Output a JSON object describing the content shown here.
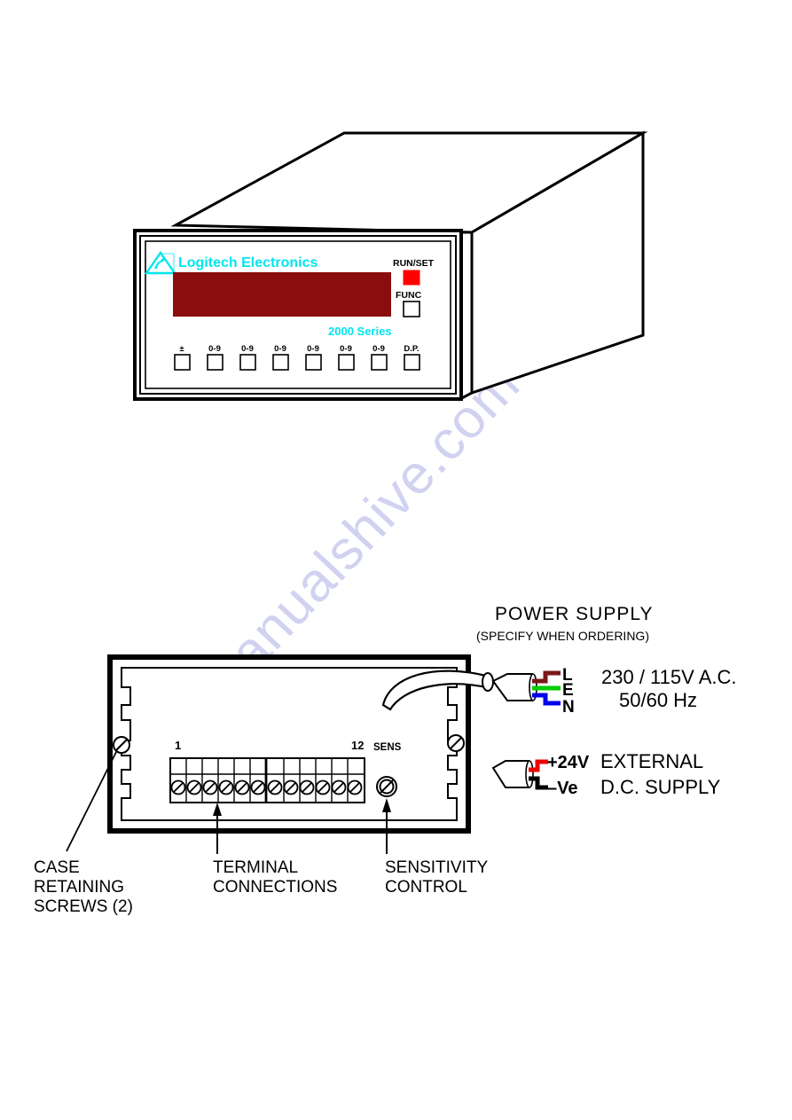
{
  "watermark": {
    "text": "manualshive.com"
  },
  "front_unit": {
    "brand": "Logitech Electronics",
    "logo_icon": "triangle-logo-icon",
    "series_label": "2000 Series",
    "display": {
      "color": "#8b0d0d",
      "value": ""
    },
    "side_buttons": [
      {
        "label": "RUN/SET",
        "state": "active",
        "color": "#ff0000"
      },
      {
        "label": "FUNC",
        "state": "inactive",
        "color": "#ffffff"
      }
    ],
    "keypad": [
      {
        "label": "±"
      },
      {
        "label": "0-9"
      },
      {
        "label": "0-9"
      },
      {
        "label": "0-9"
      },
      {
        "label": "0-9"
      },
      {
        "label": "0-9"
      },
      {
        "label": "0-9"
      },
      {
        "label": "D.P."
      }
    ]
  },
  "rear_unit": {
    "terminal_first": "1",
    "terminal_last": "12",
    "sens_label": "SENS",
    "terminal_count": 12,
    "screw_icon": "slotted-screw-icon",
    "pot_icon": "potentiometer-icon",
    "cable_icon": "mains-cable-icon"
  },
  "captions": [
    {
      "lines": [
        "CASE",
        "RETAINING",
        "SCREWS  (2)"
      ]
    },
    {
      "lines": [
        "TERMINAL",
        "CONNECTIONS"
      ]
    },
    {
      "lines": [
        "SENSITIVITY",
        "CONTROL"
      ]
    }
  ],
  "power_supply": {
    "title": "POWER  SUPPLY",
    "subtitle": "(SPECIFY  WHEN  ORDERING)",
    "ac": {
      "line1": "230 / 115V  A.C.",
      "line2": "50/60  Hz"
    },
    "ac_wires": [
      {
        "label": "L",
        "color": "#7b1818"
      },
      {
        "label": "E",
        "color": "#00cc00"
      },
      {
        "label": "N",
        "color": "#0000ee"
      }
    ],
    "dc": {
      "line1": "EXTERNAL",
      "line2": "D.C.  SUPPLY"
    },
    "dc_wires": [
      {
        "label": "+24V",
        "color": "#ee0000"
      },
      {
        "label": "–Ve",
        "color": "#000000"
      }
    ]
  }
}
